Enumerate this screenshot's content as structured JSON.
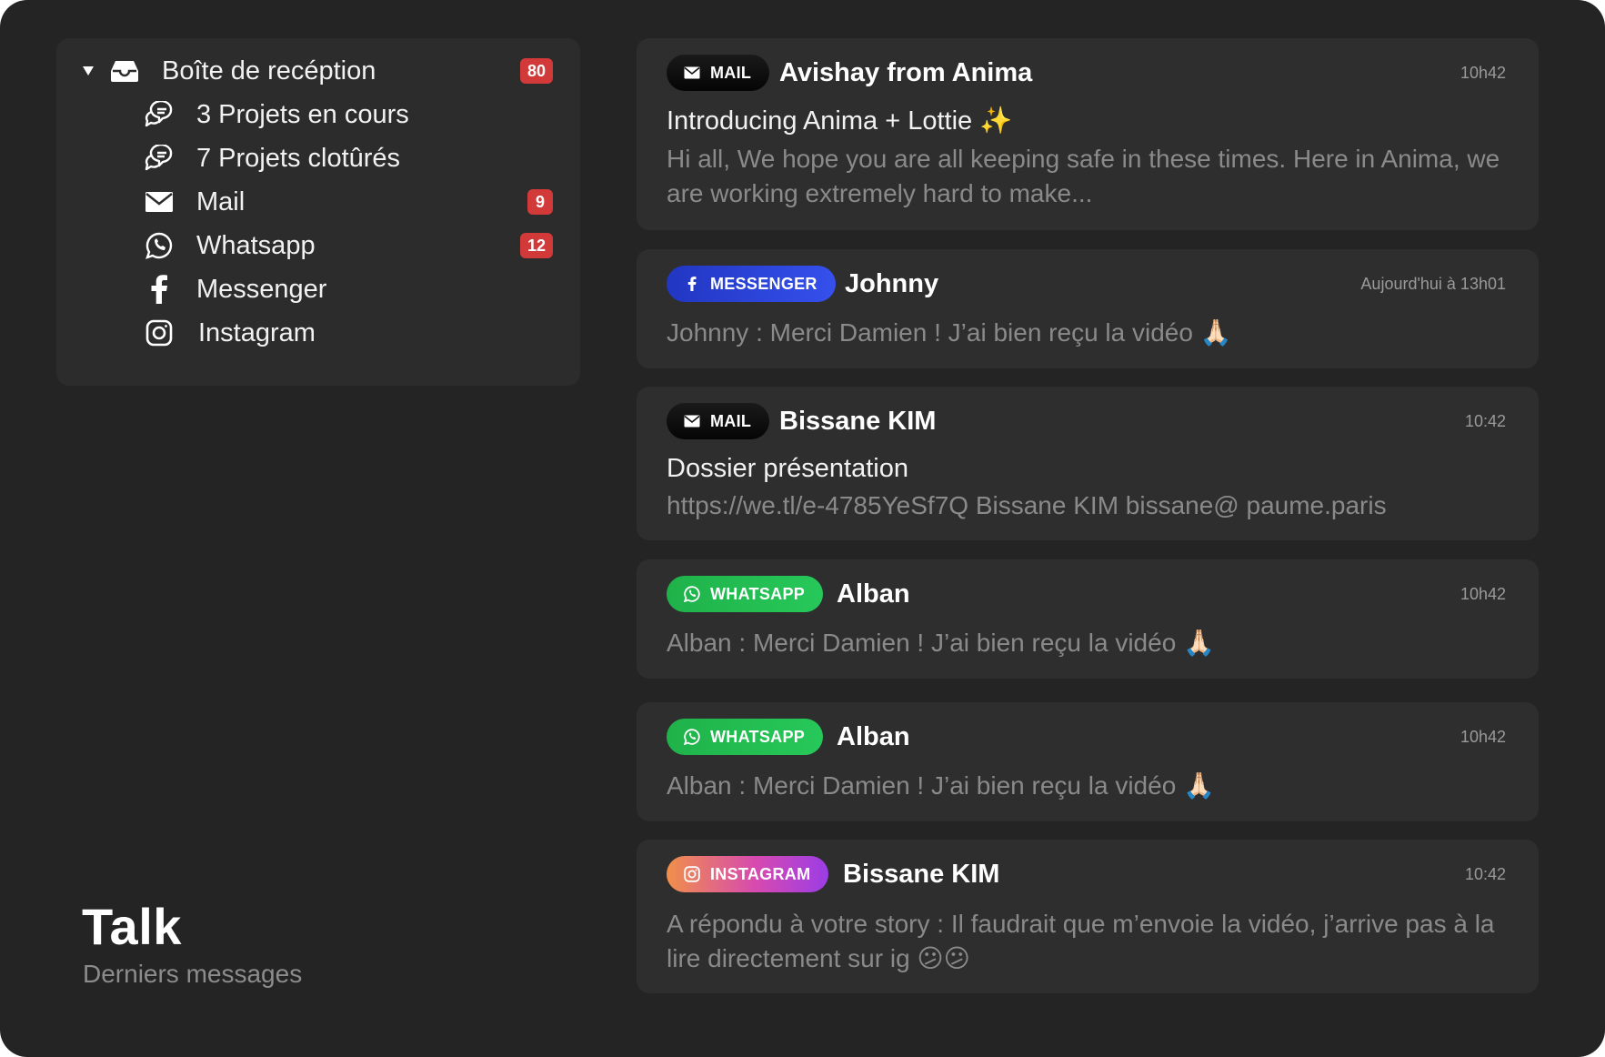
{
  "app": {
    "title": "Talk",
    "subtitle": "Derniers messages"
  },
  "sidebar": {
    "root": {
      "label": "Boîte de recéption",
      "badge": "80",
      "icon": "inbox-icon"
    },
    "items": [
      {
        "label": "3 Projets en cours",
        "icon": "chat-bubbles-icon",
        "badge": ""
      },
      {
        "label": "7 Projets clotûrés",
        "icon": "chat-bubbles-icon",
        "badge": ""
      },
      {
        "label": "Mail",
        "icon": "mail-icon",
        "badge": "9"
      },
      {
        "label": "Whatsapp",
        "icon": "whatsapp-icon",
        "badge": "12"
      },
      {
        "label": "Messenger",
        "icon": "facebook-icon",
        "badge": ""
      },
      {
        "label": "Instagram",
        "icon": "instagram-icon",
        "badge": ""
      }
    ]
  },
  "messages": [
    {
      "channel": "MAIL",
      "sender": "Avishay from Anima",
      "time": "10h42",
      "subject": "Introducing Anima + Lottie ✨",
      "preview": "Hi all, We hope you are all keeping safe in these times. Here in Anima, we are working extremely hard to make..."
    },
    {
      "channel": "MESSENGER",
      "sender": "Johnny",
      "time": "Aujourd'hui à 13h01",
      "subject": "",
      "preview": "Johnny : Merci Damien ! J’ai bien reçu la vidéo 🙏🏻"
    },
    {
      "channel": "MAIL",
      "sender": "Bissane KIM",
      "time": "10:42",
      "subject": "Dossier présentation",
      "preview": "https://we.tl/e-4785YeSf7Q Bissane KIM bissane@ paume.paris"
    },
    {
      "channel": "WHATSAPP",
      "sender": "Alban",
      "time": "10h42",
      "subject": "",
      "preview": "Alban : Merci Damien ! J’ai bien reçu la vidéo 🙏🏻"
    },
    {
      "channel": "WHATSAPP",
      "sender": "Alban",
      "time": "10h42",
      "subject": "",
      "preview": "Alban : Merci Damien ! J’ai bien reçu la vidéo 🙏🏻"
    },
    {
      "channel": "INSTAGRAM",
      "sender": "Bissane KIM",
      "time": "10:42",
      "subject": "",
      "preview": "A répondu à votre story : Il faudrait que m’envoie la vidéo, j’arrive pas à la lire directement sur ig 😕😕"
    }
  ],
  "colors": {
    "background": "#242424",
    "panel": "#2c2c2c",
    "badge": "#d23a3a",
    "mail": "#0b0b0b",
    "messenger": "#2a44e0",
    "whatsapp": "#22bd52",
    "instagram": "#d74ab0"
  }
}
